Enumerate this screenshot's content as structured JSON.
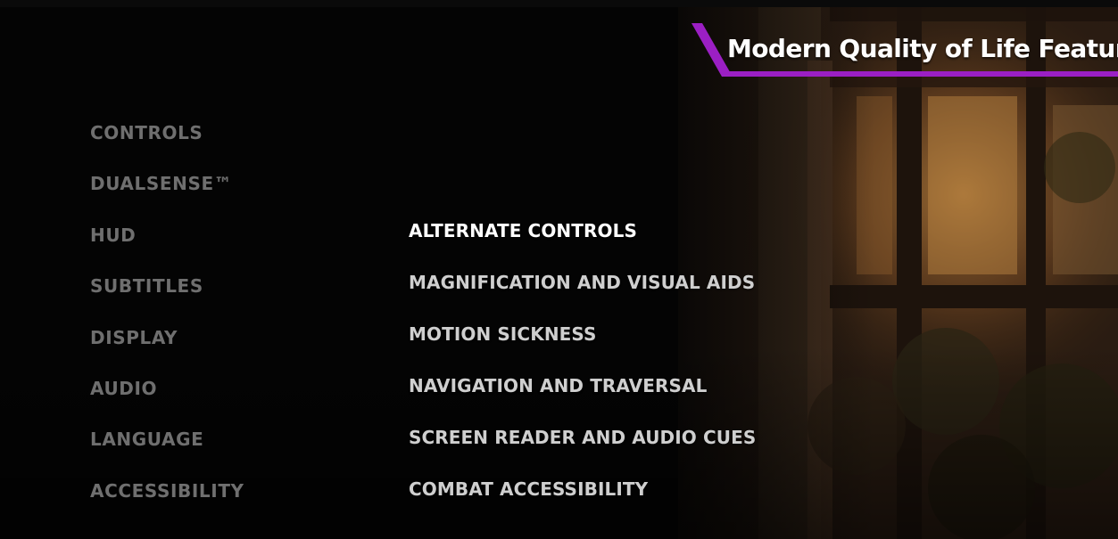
{
  "banner": {
    "title": "Modern Quality of Life Features",
    "accent_color": "#9b1fc4"
  },
  "left_menu": {
    "items": [
      {
        "label": "CONTROLS"
      },
      {
        "label": "DUALSENSE™"
      },
      {
        "label": "HUD"
      },
      {
        "label": "SUBTITLES"
      },
      {
        "label": "DISPLAY"
      },
      {
        "label": "AUDIO"
      },
      {
        "label": "LANGUAGE"
      },
      {
        "label": "ACCESSIBILITY"
      }
    ],
    "selected": "ACCESSIBILITY"
  },
  "sub_menu": {
    "items": [
      {
        "label": "ALTERNATE CONTROLS"
      },
      {
        "label": "MAGNIFICATION AND VISUAL AIDS"
      },
      {
        "label": "MOTION SICKNESS"
      },
      {
        "label": "NAVIGATION AND TRAVERSAL"
      },
      {
        "label": "SCREEN READER AND AUDIO CUES"
      },
      {
        "label": "COMBAT ACCESSIBILITY"
      }
    ],
    "highlighted": "ALTERNATE CONTROLS"
  }
}
